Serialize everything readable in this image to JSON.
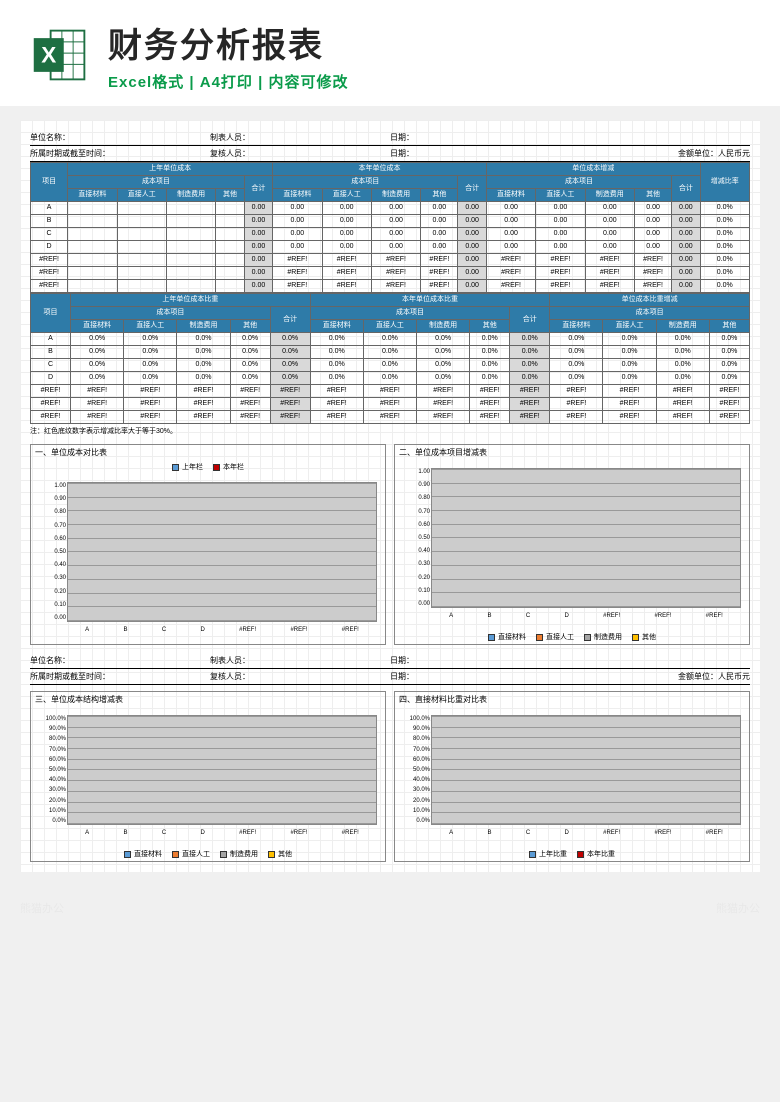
{
  "watermark": "熊猫办公",
  "header": {
    "title": "财务分析报表",
    "subtitle": "Excel格式 | A4打印 | 内容可修改"
  },
  "info": {
    "unit_label": "单位名称：",
    "period_label": "所属时期或截至时间：",
    "preparer_label": "制表人员：",
    "reviewer_label": "复核人员：",
    "date_label": "日期：",
    "currency_label": "金额单位：人民币元"
  },
  "table1": {
    "item": "项目",
    "groups": [
      "上年单位成本",
      "本年单位成本",
      "单位成本增减"
    ],
    "cost_project": "成本项目",
    "total": "合计",
    "ratio": "增减比率",
    "cols": [
      "直接材料",
      "直接人工",
      "制造费用",
      "其他"
    ],
    "rows": [
      "A",
      "B",
      "C",
      "D",
      "#REF!",
      "#REF!",
      "#REF!"
    ]
  },
  "table2": {
    "groups": [
      "上年单位成本比重",
      "本年单位成本比重",
      "单位成本比重增减"
    ],
    "rows": [
      "A",
      "B",
      "C",
      "D",
      "#REF!",
      "#REF!",
      "#REF!"
    ]
  },
  "note": "注：红色底纹数字表示增减比率大于等于30%。",
  "charts": {
    "c1_title": "一、单位成本对比表",
    "c2_title": "二、单位成本项目增减表",
    "c3_title": "三、单位成本结构增减表",
    "c4_title": "四、直接材料比重对比表",
    "legend1": [
      "上年栏",
      "本年栏"
    ],
    "legend2": [
      "直接材料",
      "直接人工",
      "制造费用",
      "其他"
    ],
    "legend4": [
      "上年比重",
      "本年比重"
    ]
  },
  "chart_data": [
    {
      "type": "bar",
      "title": "单位成本对比表",
      "categories": [
        "A",
        "B",
        "C",
        "D",
        "#REF!",
        "#REF!",
        "#REF!"
      ],
      "series": [
        {
          "name": "上年栏",
          "values": [
            0,
            0,
            0,
            0,
            0,
            0,
            0
          ]
        },
        {
          "name": "本年栏",
          "values": [
            0,
            0,
            0,
            0,
            0,
            0,
            0
          ]
        }
      ],
      "ylim": [
        0,
        1
      ],
      "yticks": [
        0,
        0.1,
        0.2,
        0.3,
        0.4,
        0.5,
        0.6,
        0.7,
        0.8,
        0.9,
        1.0
      ]
    },
    {
      "type": "bar",
      "title": "单位成本项目增减表",
      "categories": [
        "A",
        "B",
        "C",
        "D",
        "#REF!",
        "#REF!",
        "#REF!"
      ],
      "series": [
        {
          "name": "直接材料",
          "values": [
            0,
            0,
            0,
            0,
            0,
            0,
            0
          ]
        },
        {
          "name": "直接人工",
          "values": [
            0,
            0,
            0,
            0,
            0,
            0,
            0
          ]
        },
        {
          "name": "制造费用",
          "values": [
            0,
            0,
            0,
            0,
            0,
            0,
            0
          ]
        },
        {
          "name": "其他",
          "values": [
            0,
            0,
            0,
            0,
            0,
            0,
            0
          ]
        }
      ],
      "ylim": [
        0,
        1
      ],
      "yticks": [
        0,
        0.1,
        0.2,
        0.3,
        0.4,
        0.5,
        0.6,
        0.7,
        0.8,
        0.9,
        1.0
      ]
    },
    {
      "type": "bar",
      "title": "单位成本结构增减表",
      "categories": [
        "A",
        "B",
        "C",
        "D",
        "#REF!",
        "#REF!",
        "#REF!"
      ],
      "series": [
        {
          "name": "直接材料",
          "values": [
            0,
            0,
            0,
            0,
            0,
            0,
            0
          ]
        },
        {
          "name": "直接人工",
          "values": [
            0,
            0,
            0,
            0,
            0,
            0,
            0
          ]
        },
        {
          "name": "制造费用",
          "values": [
            0,
            0,
            0,
            0,
            0,
            0,
            0
          ]
        },
        {
          "name": "其他",
          "values": [
            0,
            0,
            0,
            0,
            0,
            0,
            0
          ]
        }
      ],
      "ylim": [
        0,
        100
      ],
      "yticks": [
        "0.0%",
        "10.0%",
        "20.0%",
        "30.0%",
        "40.0%",
        "50.0%",
        "60.0%",
        "70.0%",
        "80.0%",
        "90.0%",
        "100.0%"
      ]
    },
    {
      "type": "bar",
      "title": "直接材料比重对比表",
      "categories": [
        "A",
        "B",
        "C",
        "D",
        "#REF!",
        "#REF!",
        "#REF!"
      ],
      "series": [
        {
          "name": "上年比重",
          "values": [
            0,
            0,
            0,
            0,
            0,
            0,
            0
          ]
        },
        {
          "name": "本年比重",
          "values": [
            0,
            0,
            0,
            0,
            0,
            0,
            0
          ]
        }
      ],
      "ylim": [
        0,
        100
      ],
      "yticks": [
        "0.0%",
        "10.0%",
        "20.0%",
        "30.0%",
        "40.0%",
        "50.0%",
        "60.0%",
        "70.0%",
        "80.0%",
        "90.0%",
        "100.0%"
      ]
    }
  ],
  "values": {
    "zero": "0.00",
    "zpct": "0.0%",
    "ref": "#REF!"
  }
}
